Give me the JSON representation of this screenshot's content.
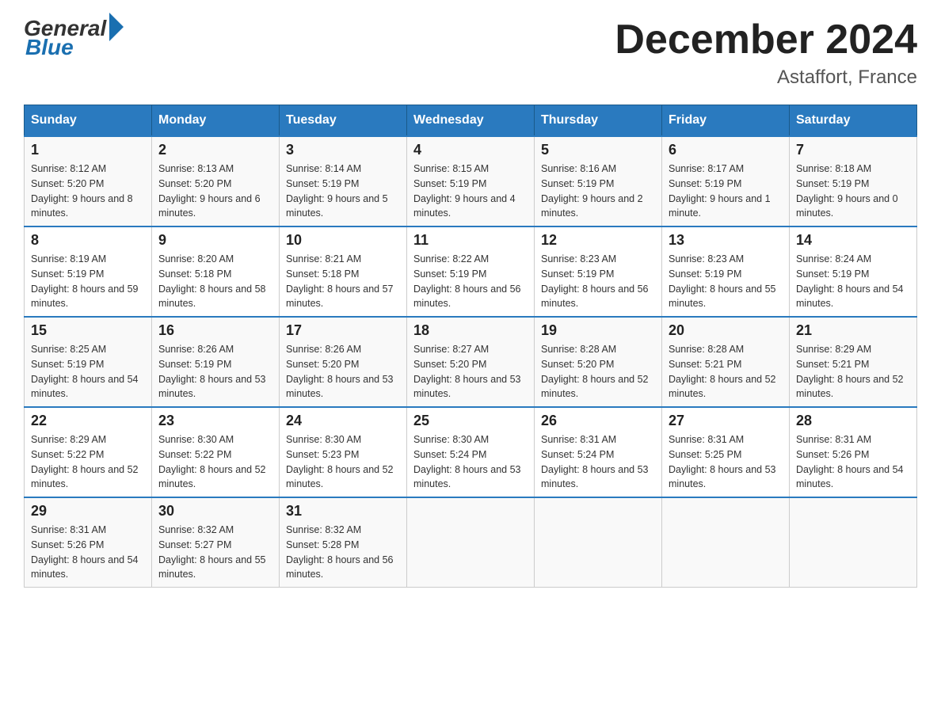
{
  "header": {
    "logo_general": "General",
    "logo_blue": "Blue",
    "month_title": "December 2024",
    "location": "Astaffort, France"
  },
  "days_of_week": [
    "Sunday",
    "Monday",
    "Tuesday",
    "Wednesday",
    "Thursday",
    "Friday",
    "Saturday"
  ],
  "weeks": [
    [
      {
        "day": "1",
        "sunrise": "8:12 AM",
        "sunset": "5:20 PM",
        "daylight": "9 hours and 8 minutes."
      },
      {
        "day": "2",
        "sunrise": "8:13 AM",
        "sunset": "5:20 PM",
        "daylight": "9 hours and 6 minutes."
      },
      {
        "day": "3",
        "sunrise": "8:14 AM",
        "sunset": "5:19 PM",
        "daylight": "9 hours and 5 minutes."
      },
      {
        "day": "4",
        "sunrise": "8:15 AM",
        "sunset": "5:19 PM",
        "daylight": "9 hours and 4 minutes."
      },
      {
        "day": "5",
        "sunrise": "8:16 AM",
        "sunset": "5:19 PM",
        "daylight": "9 hours and 2 minutes."
      },
      {
        "day": "6",
        "sunrise": "8:17 AM",
        "sunset": "5:19 PM",
        "daylight": "9 hours and 1 minute."
      },
      {
        "day": "7",
        "sunrise": "8:18 AM",
        "sunset": "5:19 PM",
        "daylight": "9 hours and 0 minutes."
      }
    ],
    [
      {
        "day": "8",
        "sunrise": "8:19 AM",
        "sunset": "5:19 PM",
        "daylight": "8 hours and 59 minutes."
      },
      {
        "day": "9",
        "sunrise": "8:20 AM",
        "sunset": "5:18 PM",
        "daylight": "8 hours and 58 minutes."
      },
      {
        "day": "10",
        "sunrise": "8:21 AM",
        "sunset": "5:18 PM",
        "daylight": "8 hours and 57 minutes."
      },
      {
        "day": "11",
        "sunrise": "8:22 AM",
        "sunset": "5:19 PM",
        "daylight": "8 hours and 56 minutes."
      },
      {
        "day": "12",
        "sunrise": "8:23 AM",
        "sunset": "5:19 PM",
        "daylight": "8 hours and 56 minutes."
      },
      {
        "day": "13",
        "sunrise": "8:23 AM",
        "sunset": "5:19 PM",
        "daylight": "8 hours and 55 minutes."
      },
      {
        "day": "14",
        "sunrise": "8:24 AM",
        "sunset": "5:19 PM",
        "daylight": "8 hours and 54 minutes."
      }
    ],
    [
      {
        "day": "15",
        "sunrise": "8:25 AM",
        "sunset": "5:19 PM",
        "daylight": "8 hours and 54 minutes."
      },
      {
        "day": "16",
        "sunrise": "8:26 AM",
        "sunset": "5:19 PM",
        "daylight": "8 hours and 53 minutes."
      },
      {
        "day": "17",
        "sunrise": "8:26 AM",
        "sunset": "5:20 PM",
        "daylight": "8 hours and 53 minutes."
      },
      {
        "day": "18",
        "sunrise": "8:27 AM",
        "sunset": "5:20 PM",
        "daylight": "8 hours and 53 minutes."
      },
      {
        "day": "19",
        "sunrise": "8:28 AM",
        "sunset": "5:20 PM",
        "daylight": "8 hours and 52 minutes."
      },
      {
        "day": "20",
        "sunrise": "8:28 AM",
        "sunset": "5:21 PM",
        "daylight": "8 hours and 52 minutes."
      },
      {
        "day": "21",
        "sunrise": "8:29 AM",
        "sunset": "5:21 PM",
        "daylight": "8 hours and 52 minutes."
      }
    ],
    [
      {
        "day": "22",
        "sunrise": "8:29 AM",
        "sunset": "5:22 PM",
        "daylight": "8 hours and 52 minutes."
      },
      {
        "day": "23",
        "sunrise": "8:30 AM",
        "sunset": "5:22 PM",
        "daylight": "8 hours and 52 minutes."
      },
      {
        "day": "24",
        "sunrise": "8:30 AM",
        "sunset": "5:23 PM",
        "daylight": "8 hours and 52 minutes."
      },
      {
        "day": "25",
        "sunrise": "8:30 AM",
        "sunset": "5:24 PM",
        "daylight": "8 hours and 53 minutes."
      },
      {
        "day": "26",
        "sunrise": "8:31 AM",
        "sunset": "5:24 PM",
        "daylight": "8 hours and 53 minutes."
      },
      {
        "day": "27",
        "sunrise": "8:31 AM",
        "sunset": "5:25 PM",
        "daylight": "8 hours and 53 minutes."
      },
      {
        "day": "28",
        "sunrise": "8:31 AM",
        "sunset": "5:26 PM",
        "daylight": "8 hours and 54 minutes."
      }
    ],
    [
      {
        "day": "29",
        "sunrise": "8:31 AM",
        "sunset": "5:26 PM",
        "daylight": "8 hours and 54 minutes."
      },
      {
        "day": "30",
        "sunrise": "8:32 AM",
        "sunset": "5:27 PM",
        "daylight": "8 hours and 55 minutes."
      },
      {
        "day": "31",
        "sunrise": "8:32 AM",
        "sunset": "5:28 PM",
        "daylight": "8 hours and 56 minutes."
      },
      null,
      null,
      null,
      null
    ]
  ]
}
